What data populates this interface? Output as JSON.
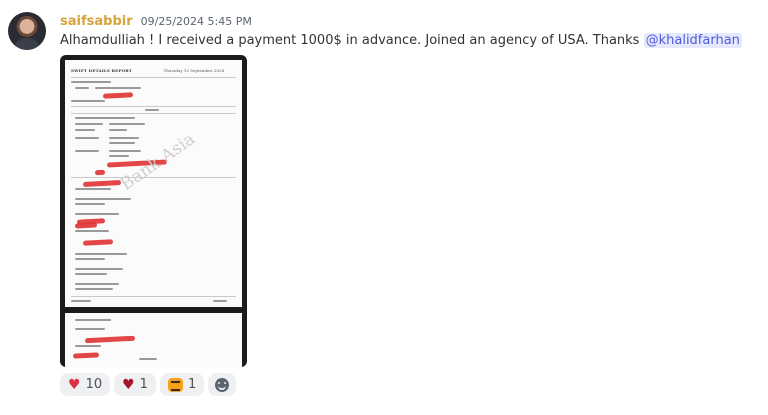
{
  "message": {
    "username": "saifsabbir",
    "timestamp": "09/25/2024 5:45 PM",
    "text": "Alhamdulliah !  I received a payment 1000$ in advance. Joined an agency of USA. Thanks ",
    "mention": "@khalidfarhan",
    "username_color": "#d6a43a"
  },
  "attachment": {
    "doc_title": "SWIFT DETAILS REPORT",
    "doc_date": "Thursday 12 September 2024",
    "watermark": "Bank Asia"
  },
  "reactions": [
    {
      "emoji": "red-heart-icon",
      "count": "10"
    },
    {
      "emoji": "dark-red-heart-icon",
      "count": "1"
    },
    {
      "emoji": "tiger-icon",
      "count": "1"
    }
  ]
}
